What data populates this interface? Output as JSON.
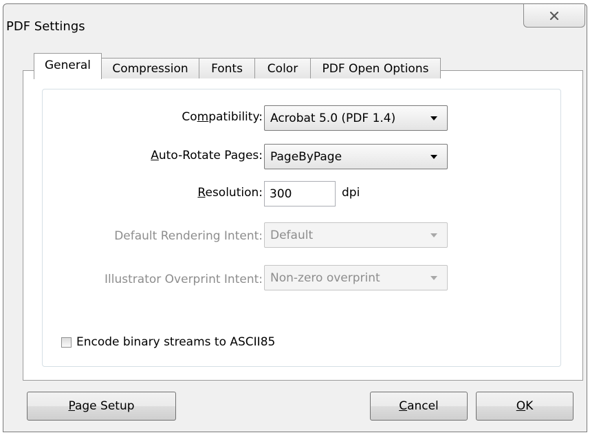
{
  "window": {
    "title": "PDF Settings"
  },
  "tabs": [
    {
      "label": "General",
      "active": true
    },
    {
      "label": "Compression",
      "active": false
    },
    {
      "label": "Fonts",
      "active": false
    },
    {
      "label": "Color",
      "active": false
    },
    {
      "label": "PDF Open Options",
      "active": false
    }
  ],
  "general": {
    "compatibility": {
      "label_pre": "Co",
      "label_u": "m",
      "label_post": "patibility:",
      "value": "Acrobat 5.0 (PDF 1.4)"
    },
    "auto_rotate": {
      "label_u": "A",
      "label_post": "uto-Rotate Pages:",
      "value": "PageByPage"
    },
    "resolution": {
      "label_u": "R",
      "label_post": "esolution:",
      "value": "300",
      "unit": "dpi"
    },
    "rendering_intent": {
      "label": "Default Rendering Intent:",
      "value": "Default",
      "enabled": false
    },
    "overprint_intent": {
      "label": "Illustrator Overprint Intent:",
      "value": "Non-zero overprint",
      "enabled": false
    },
    "encode_ascii85": {
      "label": "Encode binary streams to ASCII85",
      "checked": false
    }
  },
  "buttons": {
    "page_setup": {
      "label_u": "P",
      "label_post": "age Setup"
    },
    "cancel": {
      "label_u": "C",
      "label_post": "ancel"
    },
    "ok": {
      "label_u": "O",
      "label_post": "K"
    }
  },
  "icons": {
    "close": "close-icon",
    "dropdown": "chevron-down-icon"
  }
}
